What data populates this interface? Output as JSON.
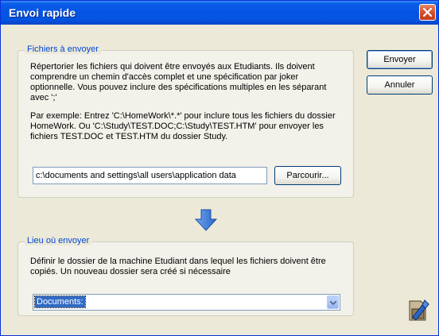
{
  "window": {
    "title": "Envoi rapide"
  },
  "files_group": {
    "legend": "Fichiers à envoyer",
    "description_1": "Répertorier les fichiers qui doivent être envoyés aux Etudiants. Ils doivent comprendre un chemin d'accès complet et une spécification par joker optionnelle. Vous pouvez inclure des spécifications multiples en les séparant avec ';'",
    "description_2": "Par exemple: Entrez 'C:\\HomeWork\\*.*' pour inclure tous les fichiers du dossier HomeWork. Ou 'C:\\Study\\TEST.DOC;C:\\Study\\TEST.HTM' pour envoyer les fichiers TEST.DOC et TEST.HTM du dossier Study.",
    "path_value": "c:\\documents and settings\\all users\\application data",
    "browse_label": "Parcourir..."
  },
  "dest_group": {
    "legend": "Lieu où envoyer",
    "description": "Définir le dossier de la machine Etudiant dans lequel les fichiers doivent être copiés. Un nouveau dossier sera créé si nécessaire",
    "selected_folder": "Documents:"
  },
  "buttons": {
    "send_label": "Envoyer",
    "cancel_label": "Annuler"
  },
  "icons": {
    "arrow": "arrow-down-icon",
    "app": "send-files-icon",
    "close": "close-icon"
  },
  "colors": {
    "titlebar": "#0554e3",
    "legend": "#0046d5",
    "close": "#d4502d"
  }
}
